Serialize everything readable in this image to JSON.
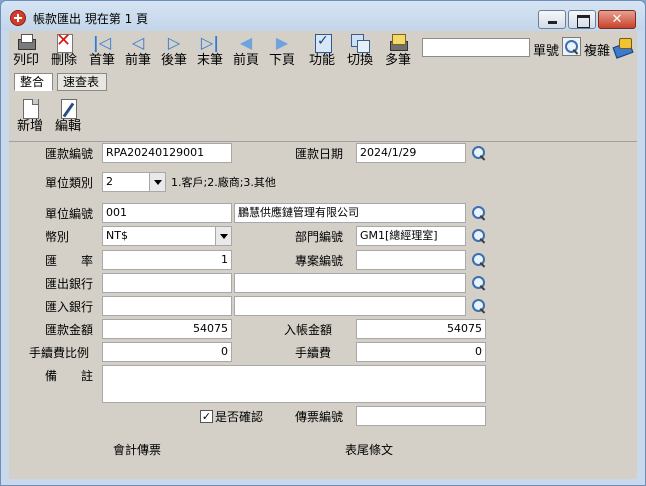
{
  "window": {
    "title": "帳款匯出  現在第 1 頁"
  },
  "toolbar": {
    "items": [
      {
        "label": "列印",
        "icon": "print-icon"
      },
      {
        "label": "刪除",
        "icon": "delete-icon"
      },
      {
        "label": "首筆",
        "icon": "first-record-icon"
      },
      {
        "label": "前筆",
        "icon": "previous-record-icon"
      },
      {
        "label": "後筆",
        "icon": "next-record-icon"
      },
      {
        "label": "末筆",
        "icon": "last-record-icon"
      },
      {
        "label": "前頁",
        "icon": "previous-page-icon"
      },
      {
        "label": "下頁",
        "icon": "next-page-icon"
      },
      {
        "label": "功能",
        "icon": "function-icon"
      },
      {
        "label": "切換",
        "icon": "switch-icon"
      },
      {
        "label": "多筆",
        "icon": "multi-record-icon"
      }
    ],
    "search_value": "",
    "search_label": "單號",
    "complex_label": "複雜"
  },
  "tabs": [
    {
      "label": "整合",
      "active": true
    },
    {
      "label": "速查表",
      "active": false
    }
  ],
  "actions": {
    "new_label": "新增",
    "edit_label": "編輯"
  },
  "form": {
    "remit_no_label": "匯款編號",
    "remit_no": "RPA20240129001",
    "remit_date_label": "匯款日期",
    "remit_date": "2024/1/29",
    "unit_type_label": "單位類別",
    "unit_type": "2",
    "unit_type_hint": "1.客戶;2.廠商;3.其他",
    "unit_no_label": "單位編號",
    "unit_no": "001",
    "unit_name": "鵬慧供應鏈管理有限公司",
    "currency_label": "幣別",
    "currency": "NT$",
    "dept_no_label": "部門編號",
    "dept_no": "GM1[總經理室]",
    "rate_label": "匯　　率",
    "rate": "1",
    "project_no_label": "專案編號",
    "project_no": "",
    "out_bank_label": "匯出銀行",
    "out_bank_code": "",
    "out_bank_name": "",
    "in_bank_label": "匯入銀行",
    "in_bank_code": "",
    "in_bank_name": "",
    "remit_amount_label": "匯款金額",
    "remit_amount": "54075",
    "entry_amount_label": "入帳金額",
    "entry_amount": "54075",
    "fee_ratio_label": "手續費比例",
    "fee_ratio": "0",
    "fee_label": "手續費",
    "fee": "0",
    "remark_label": "備　　註",
    "remark": "",
    "confirm_label": "是否確認",
    "confirm_checked": "✓",
    "voucher_no_label": "傳票編號",
    "voucher_no": ""
  },
  "footer": {
    "accounting_voucher": "會計傳票",
    "footer_text": "表尾條文"
  }
}
